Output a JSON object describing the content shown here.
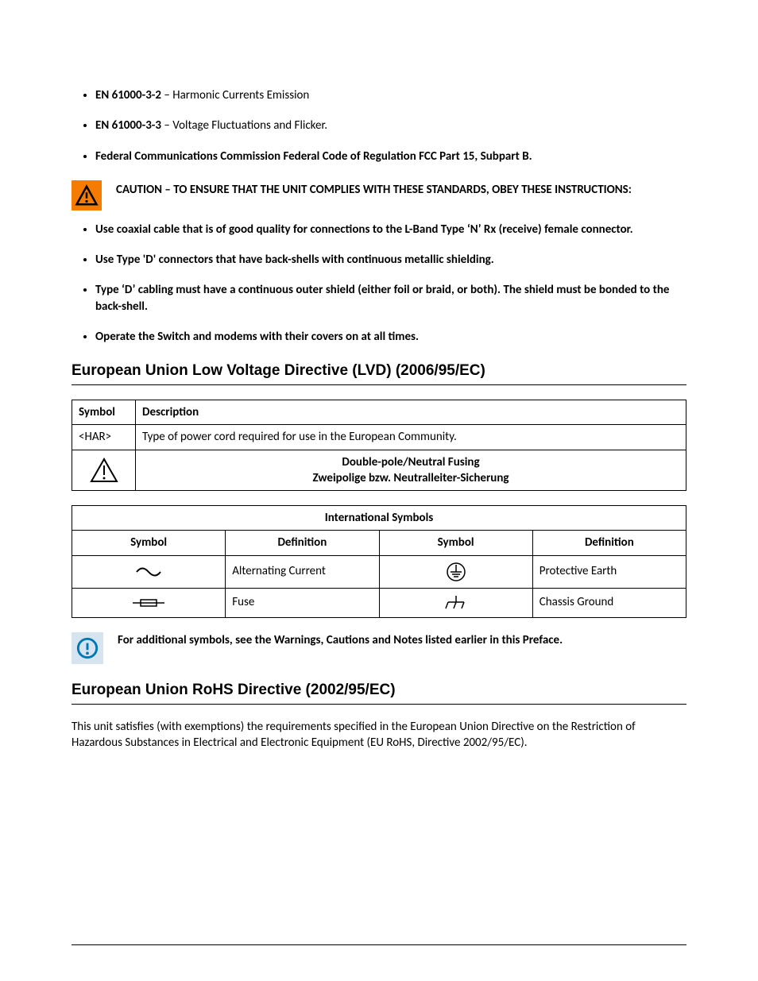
{
  "bullets_top": [
    {
      "bold": "EN 61000-3-2",
      "rest": " – Harmonic Currents Emission"
    },
    {
      "bold": "EN 61000-3-3",
      "rest": " – Voltage Fluctuations and Flicker."
    },
    {
      "bold": "Federal Communications Commission Federal Code of Regulation FCC Part 15, Subpart B.",
      "rest": ""
    }
  ],
  "caution": "CAUTION – TO ENSURE THAT THE UNIT COMPLIES WITH THESE STANDARDS, OBEY THESE INSTRUCTIONS:",
  "bullets_inst": [
    "Use coaxial cable that is of good quality for connections to the L-Band Type ‘N’ Rx (receive) female connector.",
    "Use Type 'D' connectors that have back-shells with continuous metallic shielding.",
    "Type ‘D’ cabling must have a continuous outer shield (either foil or braid, or both). The shield must be bonded to the back-shell.",
    "Operate the Switch and modems with their covers on at all times."
  ],
  "heading_lvd": "European Union Low Voltage Directive (LVD) (2006/95/EC)",
  "lvd_table": {
    "h_symbol": "Symbol",
    "h_desc": "Description",
    "r1_sym": "<HAR>",
    "r1_desc": "Type of power cord required for use in the European Community.",
    "r2_line1": "Double-pole/Neutral Fusing",
    "r2_line2": "Zweipolige bzw. Neutralleiter-Sicherung"
  },
  "intl_table": {
    "title": "International Symbols",
    "h_symbol": "Symbol",
    "h_def": "Definition",
    "ac": "Alternating Current",
    "pe": "Protective Earth",
    "fuse": "Fuse",
    "cg": "Chassis Ground"
  },
  "info_text": "For additional symbols, see the Warnings, Cautions and Notes listed earlier in this Preface.",
  "heading_rohs": "European Union RoHS Directive (2002/95/EC)",
  "rohs_text": "This unit satisfies (with exemptions) the requirements specified in the European Union Directive on the Restriction of Hazardous Substances in Electrical and Electronic Equipment (EU RoHS, Directive 2002/95/EC)."
}
